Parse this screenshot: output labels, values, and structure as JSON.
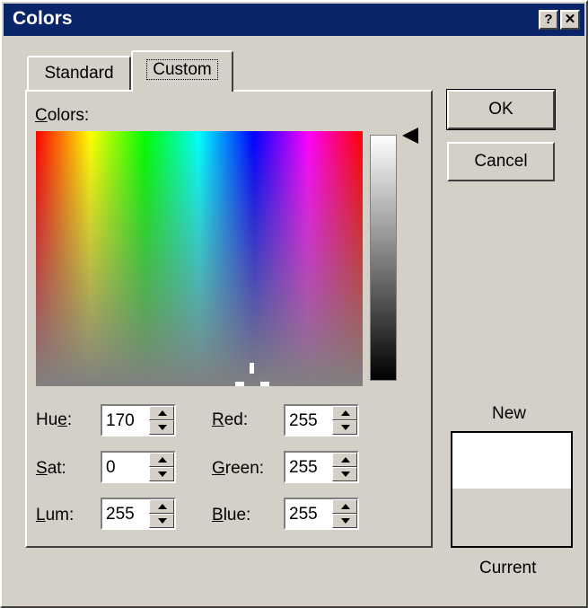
{
  "window": {
    "title": "Colors",
    "help_glyph": "?",
    "close_glyph": "✕"
  },
  "tabs": [
    {
      "label": "Standard",
      "active": false
    },
    {
      "label": "Custom",
      "active": true
    }
  ],
  "colors_label": {
    "mnemonic": "C",
    "rest": "olors:"
  },
  "spectrum": {
    "hues": [
      "#ff0000",
      "#ffff00",
      "#00ff00",
      "#00ffff",
      "#0000ff",
      "#ff00ff",
      "#ff0000"
    ]
  },
  "fields": {
    "hue": {
      "mnemonic": "e",
      "pre": "Hu",
      "post": ":",
      "value": "170"
    },
    "sat": {
      "mnemonic": "S",
      "pre": "",
      "post": "at:",
      "value": "0"
    },
    "lum": {
      "mnemonic": "L",
      "pre": "",
      "post": "um:",
      "value": "255"
    },
    "red": {
      "mnemonic": "R",
      "pre": "",
      "post": "ed:",
      "value": "255"
    },
    "green": {
      "mnemonic": "G",
      "pre": "",
      "post": "reen:",
      "value": "255"
    },
    "blue": {
      "mnemonic": "B",
      "pre": "",
      "post": "lue:",
      "value": "255"
    }
  },
  "buttons": {
    "ok": "OK",
    "cancel": "Cancel"
  },
  "preview": {
    "new_label": "New",
    "current_label": "Current",
    "new_color": "#ffffff",
    "current_color": "#d4d0c8"
  },
  "colors": {
    "titlebar": "#0a246a",
    "face": "#d4d0c8"
  }
}
